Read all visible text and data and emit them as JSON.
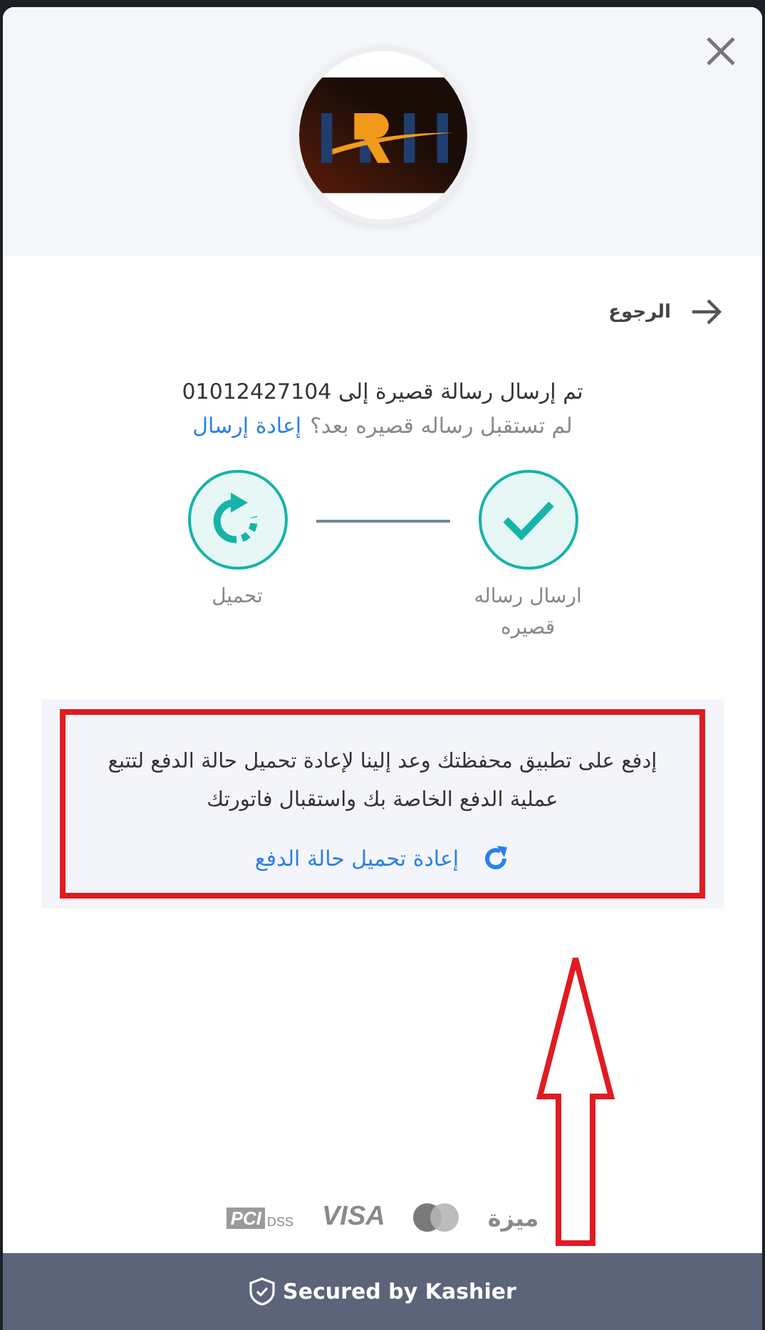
{
  "back": {
    "label": "الرجوع"
  },
  "message": {
    "sent": "تم إرسال رسالة قصيرة إلى 01012427104",
    "question": "لم تستقبل رساله قصيره بعد؟",
    "resend": "إعادة إرسال"
  },
  "steps": [
    {
      "kind": "done",
      "label": "ارسال رساله قصيره"
    },
    {
      "kind": "loading",
      "label": "تحميل"
    }
  ],
  "notice": {
    "text": "إدفع على تطبيق محفظتك وعد إلينا لإعادة تحميل حالة الدفع لتتبع عملية الدفع الخاصة بك واستقبال فاتورتك",
    "reload": "إعادة تحميل حالة الدفع",
    "highlighted": true
  },
  "payment_logos": [
    {
      "kind": "meeza",
      "text": "ميزة"
    },
    {
      "kind": "mastercard"
    },
    {
      "kind": "visa",
      "text": "VISA"
    },
    {
      "kind": "pci",
      "text": "PCI",
      "sub": "DSS"
    }
  ],
  "footer": {
    "text": "Secured by Kashier"
  }
}
